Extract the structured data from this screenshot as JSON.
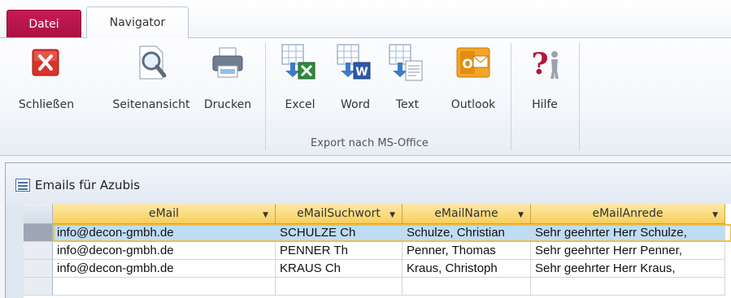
{
  "tabs": {
    "file": "Datei",
    "navigator": "Navigator"
  },
  "ribbon": {
    "close": "Schließen",
    "preview": "Seitenansicht",
    "print": "Drucken",
    "excel": "Excel",
    "word": "Word",
    "text": "Text",
    "outlook": "Outlook",
    "help": "Hilfe",
    "export_group": "Export nach MS-Office"
  },
  "form": {
    "title": "Emails für Azubis",
    "columns": [
      "eMail",
      "eMailSuchwort",
      "eMailName",
      "eMailAnrede"
    ],
    "rows": [
      [
        "info@decon-gmbh.de",
        "SCHULZE Ch",
        "Schulze, Christian",
        "Sehr geehrter Herr Schulze,"
      ],
      [
        "info@decon-gmbh.de",
        "PENNER Th",
        "Penner, Thomas",
        "Sehr geehrter Herr Penner,"
      ],
      [
        "info@decon-gmbh.de",
        "KRAUS Ch",
        "Kraus, Christoph",
        "Sehr geehrter Herr Kraus,"
      ]
    ]
  },
  "colors": {
    "file_tab": "#b8154a",
    "header": "#f8cf5c",
    "selected_row": "#bfdcf5"
  }
}
